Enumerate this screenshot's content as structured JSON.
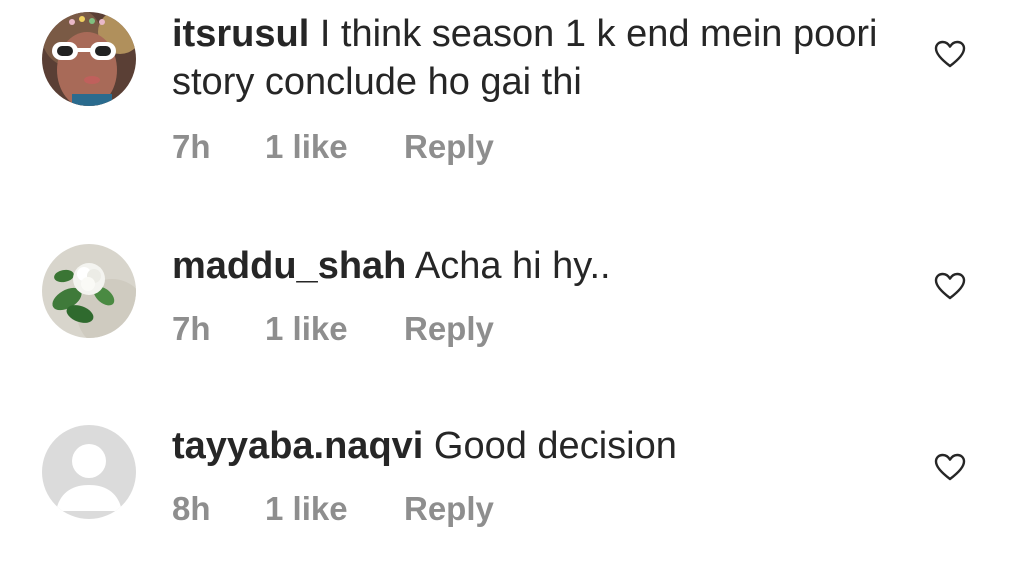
{
  "comments": [
    {
      "username": "itsrusul",
      "text": "I think season 1 k end mein poori story conclude ho gai thi",
      "time": "7h",
      "likes": "1 like",
      "reply": "Reply",
      "avatar_icon": "profile-photo-sunglasses",
      "like_icon": "heart-outline-icon"
    },
    {
      "username": "maddu_shah",
      "text": "Acha hi hy..",
      "time": "7h",
      "likes": "1 like",
      "reply": "Reply",
      "avatar_icon": "profile-photo-flower",
      "like_icon": "heart-outline-icon"
    },
    {
      "username": "tayyaba.naqvi",
      "text": "Good decision",
      "time": "8h",
      "likes": "1 like",
      "reply": "Reply",
      "avatar_icon": "default-profile-icon",
      "like_icon": "heart-outline-icon"
    }
  ],
  "colors": {
    "text": "#262626",
    "meta": "#8e8e8e",
    "default_avatar_bg": "#dbdbdb"
  }
}
